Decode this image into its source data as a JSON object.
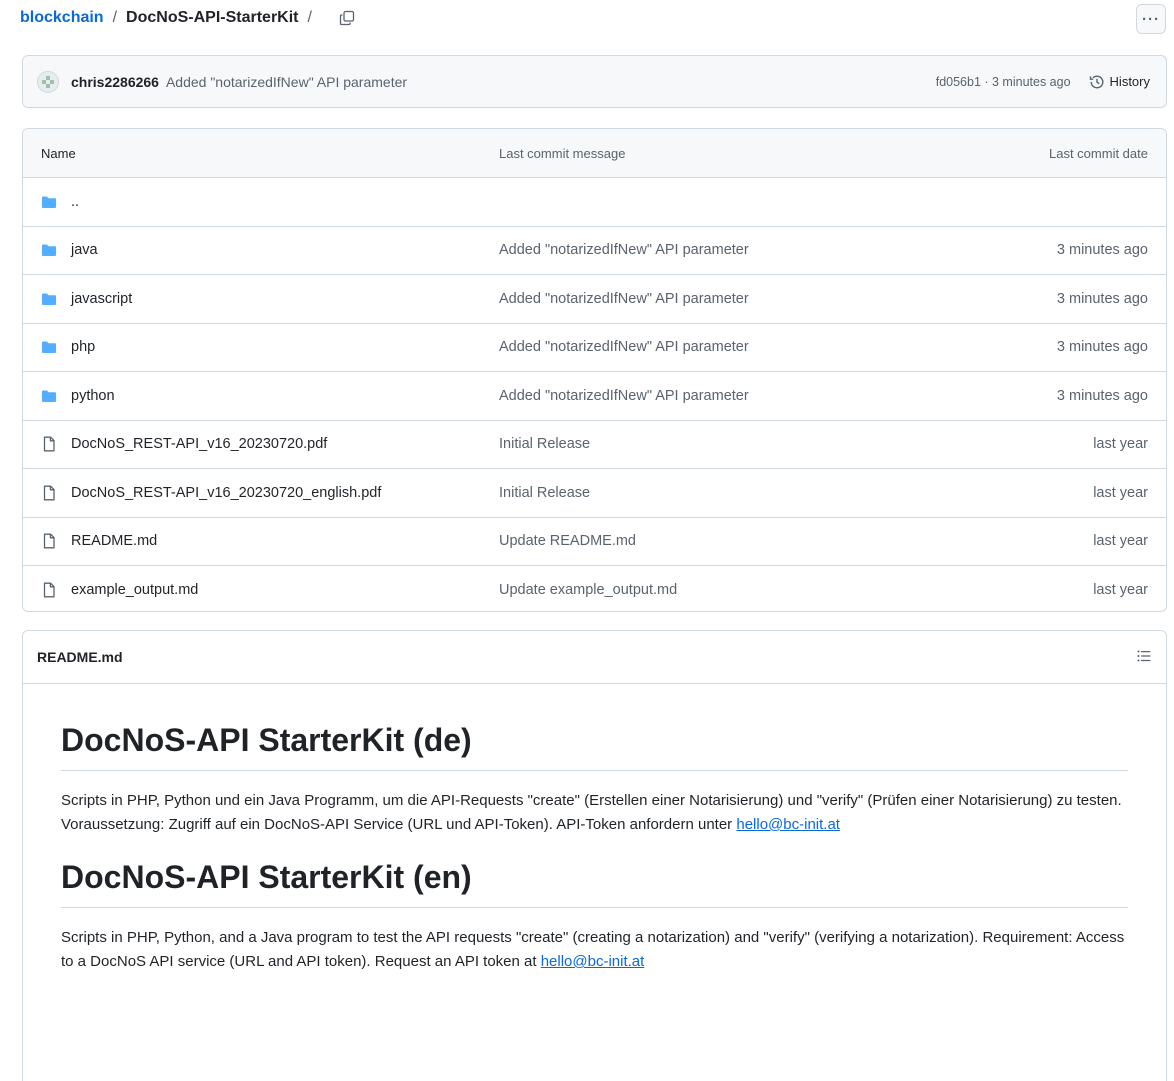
{
  "breadcrumb": {
    "repo_link": "blockchain",
    "separator": "/",
    "current": "DocNoS-API-StarterKit",
    "trailing_sep": "/"
  },
  "more_button": "···",
  "latest_commit": {
    "author": "chris2286266",
    "message": "Added \"notarizedIfNew\" API parameter",
    "sha_and_time": "fd056b1 · 3 minutes ago",
    "history_label": "History"
  },
  "table": {
    "headers": {
      "name": "Name",
      "message": "Last commit message",
      "date": "Last commit date"
    },
    "parent_dir": "..",
    "rows": [
      {
        "type": "folder",
        "name": "java",
        "message": "Added \"notarizedIfNew\" API parameter",
        "date": "3 minutes ago"
      },
      {
        "type": "folder",
        "name": "javascript",
        "message": "Added \"notarizedIfNew\" API parameter",
        "date": "3 minutes ago"
      },
      {
        "type": "folder",
        "name": "php",
        "message": "Added \"notarizedIfNew\" API parameter",
        "date": "3 minutes ago"
      },
      {
        "type": "folder",
        "name": "python",
        "message": "Added \"notarizedIfNew\" API parameter",
        "date": "3 minutes ago"
      },
      {
        "type": "file",
        "name": "DocNoS_REST-API_v16_20230720.pdf",
        "message": "Initial Release",
        "date": "last year"
      },
      {
        "type": "file",
        "name": "DocNoS_REST-API_v16_20230720_english.pdf",
        "message": "Initial Release",
        "date": "last year"
      },
      {
        "type": "file",
        "name": "README.md",
        "message": "Update README.md",
        "date": "last year"
      },
      {
        "type": "file",
        "name": "example_output.md",
        "message": "Update example_output.md",
        "date": "last year"
      }
    ]
  },
  "readme": {
    "filename": "README.md",
    "heading_de": "DocNoS-API StarterKit (de)",
    "para_de": "Scripts in PHP, Python und ein Java Programm, um die API-Requests \"create\" (Erstellen einer Notarisierung) und \"verify\" (Prüfen einer Notarisierung) zu testen. Voraussetzung: Zugriff auf ein DocNoS-API Service (URL und API-Token). API-Token anfordern unter ",
    "email_de": "hello@bc-init.at",
    "heading_en": "DocNoS-API StarterKit (en)",
    "para_en": "Scripts in PHP, Python, and a Java program to test the API requests \"create\" (creating a notarization) and \"verify\" (verifying a notarization). Requirement: Access to a DocNoS API service (URL and API token). Request an API token at ",
    "email_en": "hello@bc-init.at"
  },
  "colors": {
    "link": "#0969da",
    "folder": "#54aeff",
    "muted": "#59636e",
    "border": "#d1d9e0"
  },
  "icons": {
    "folder": "folder-icon",
    "file": "file-icon",
    "copy": "copy-icon",
    "history": "history-icon",
    "toc": "list-icon"
  }
}
